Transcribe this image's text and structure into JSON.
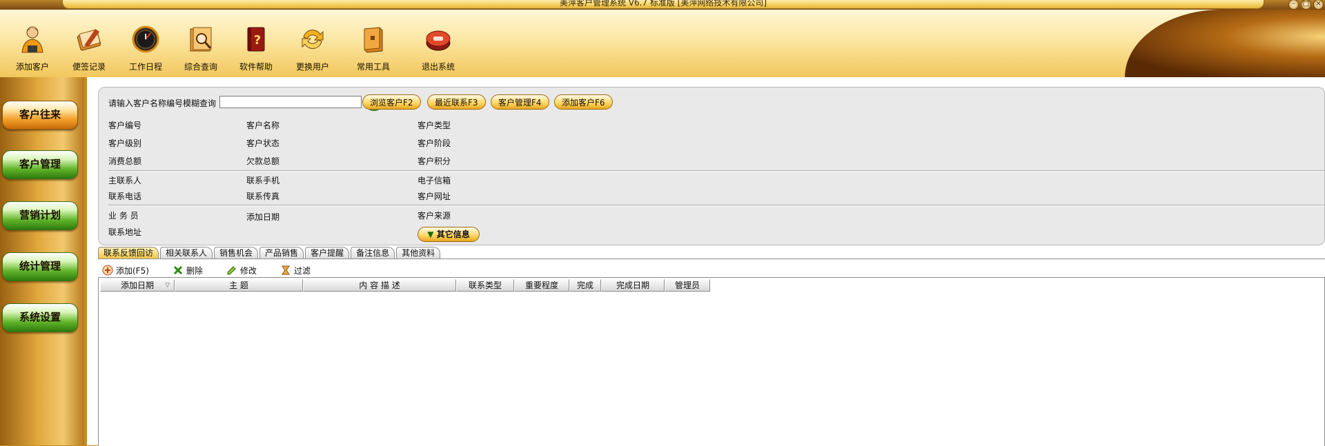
{
  "window": {
    "title": "美萍客户管理系统 V6.7 标准版 [美萍网络技术有限公司]"
  },
  "toolbar": {
    "items": [
      {
        "label": "添加客户",
        "icon": "person-icon"
      },
      {
        "label": "便签记录",
        "icon": "notepad-icon"
      },
      {
        "label": "工作日程",
        "icon": "clock-icon"
      },
      {
        "label": "综合查询",
        "icon": "magnifier-folder-icon"
      },
      {
        "label": "软件帮助",
        "icon": "help-book-icon"
      },
      {
        "label": "更换用户",
        "icon": "swap-arrows-icon"
      },
      {
        "label": "常用工具",
        "icon": "toolbox-icon"
      },
      {
        "label": "退出系统",
        "icon": "exit-icon"
      }
    ]
  },
  "sidebar": {
    "items": [
      {
        "label": "客户往来",
        "active": true
      },
      {
        "label": "客户管理",
        "active": false
      },
      {
        "label": "营销计划",
        "active": false
      },
      {
        "label": "统计管理",
        "active": false
      },
      {
        "label": "系统设置",
        "active": false
      }
    ]
  },
  "search": {
    "label": "请输入客户名称编号模糊查询",
    "value": "",
    "buttons": [
      "浏览客户F2",
      "最近联系F3",
      "客户管理F4",
      "添加客户F6"
    ]
  },
  "fields": {
    "customer_no": "客户编号",
    "customer_name": "客户名称",
    "customer_type": "客户类型",
    "customer_level": "客户级别",
    "customer_status": "客户状态",
    "customer_stage": "客户阶段",
    "total_spend": "消费总额",
    "total_debt": "欠款总额",
    "customer_points": "客户积分",
    "main_contact": "主联系人",
    "contact_mobile": "联系手机",
    "email": "电子信箱",
    "contact_phone": "联系电话",
    "contact_fax": "联系传真",
    "website": "客户网址",
    "salesman": "业 务 员",
    "add_date": "添加日期",
    "source": "客户来源",
    "address": "联系地址",
    "other_info_button": "其它信息"
  },
  "tabs": [
    "联系反馈回访",
    "相关联系人",
    "销售机会",
    "产品销售",
    "客户提醒",
    "备注信息",
    "其他资料"
  ],
  "grid_tools": {
    "add": "添加(F5)",
    "delete": "删除",
    "edit": "修改",
    "filter": "过滤"
  },
  "grid": {
    "columns": [
      "添加日期",
      "主 题",
      "内 容 描 述",
      "联系类型",
      "重要程度",
      "完成",
      "完成日期",
      "管理员"
    ]
  }
}
